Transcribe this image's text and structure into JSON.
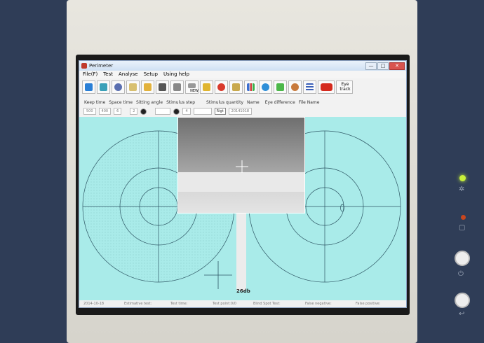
{
  "window": {
    "title": "Perimeter",
    "controls": [
      "—",
      "□",
      "✕"
    ]
  },
  "menu": [
    "File(F)",
    "Test",
    "Analyse",
    "Setup",
    "Using help"
  ],
  "toolbar": {
    "new_label": "NEW",
    "eye_track_label_1": "Eye",
    "eye_track_label_2": "track"
  },
  "params": {
    "labels": [
      "Keep time",
      "Space time",
      "Sitting angle",
      "Stimulus step",
      "Stimulus quantity",
      "Name",
      "Eye difference",
      "File Name"
    ],
    "keep_time": "500",
    "space_time": "400",
    "sitting_angle": "6",
    "stimulus_step": "2",
    "stimulus_quantity": "4",
    "eye_difference": "Rigt",
    "file_name": "20141018"
  },
  "canvas": {
    "db_label": "26db"
  },
  "statusbar": {
    "date": "2014-10-18",
    "estimative_test": "Estimative test:",
    "test_time": "Test time:",
    "test_point": "Test point:0/0",
    "blind_spot_test": "Blind Spot Test:",
    "false_negative": "False negative:",
    "false_positive": "False positive:"
  },
  "colors": {
    "canvas_bg": "#a9ebe9",
    "led_green": "#c8f03a",
    "led_red": "#c8461e"
  }
}
